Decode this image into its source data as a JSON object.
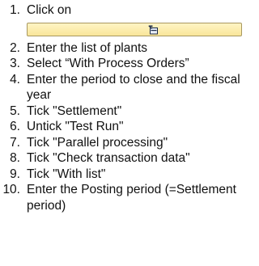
{
  "steps": [
    {
      "num": "1.",
      "text": "Click on"
    },
    {
      "num": "2.",
      "text": "Enter the list of plants"
    },
    {
      "num": "3.",
      "text": "Select “With Process Orders”"
    },
    {
      "num": "4.",
      "text": "Enter the period to close and the fiscal year"
    },
    {
      "num": "5.",
      "text": "Tick \"Settlement\""
    },
    {
      "num": "6.",
      "text": "Untick \"Test Run\""
    },
    {
      "num": "7.",
      "text": "Tick \"Parallel processing\""
    },
    {
      "num": "8.",
      "text": "Tick \"Check transaction data\""
    },
    {
      "num": "9.",
      "text": "Tick \"With list\""
    },
    {
      "num": "10.",
      "text": "Enter the Posting period (=Settlement period)"
    }
  ],
  "execute_button": {
    "icon": "execute-icon"
  }
}
